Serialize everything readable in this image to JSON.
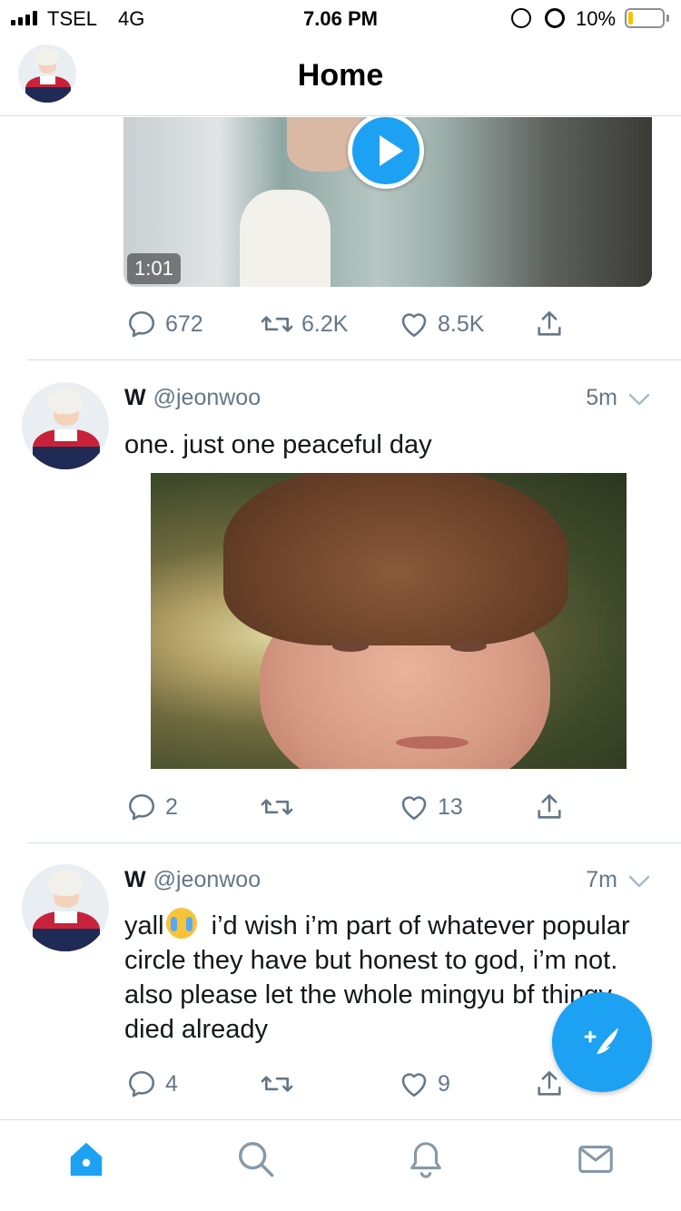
{
  "status_bar": {
    "carrier": "TSEL",
    "network": "4G",
    "time": "7.06 PM",
    "battery_percent": "10%",
    "battery_level": 0.1,
    "icons": [
      "signal-bars-icon",
      "orientation-lock-icon",
      "alarm-icon",
      "battery-icon"
    ]
  },
  "header": {
    "title": "Home"
  },
  "tweets": [
    {
      "media": {
        "type": "video",
        "duration": "1:01"
      },
      "actions": {
        "replies": "672",
        "retweets": "6.2K",
        "likes": "8.5K"
      }
    },
    {
      "name": "W",
      "handle": "@jeonwoo",
      "time": "5m",
      "text": "one. just one peaceful day",
      "media": {
        "type": "photo"
      },
      "actions": {
        "replies": "2",
        "retweets": "",
        "likes": "13"
      }
    },
    {
      "name": "W",
      "handle": "@jeonwoo",
      "time": "7m",
      "text_before_emoji": "yall",
      "emoji": "loudly-crying-face",
      "text_after_emoji": "  i’d wish i’m part of whatever popular circle they have but honest to god, i’m not. also please let the whole mingyu bf thingy died already",
      "actions": {
        "replies": "4",
        "retweets": "",
        "likes": "9"
      }
    }
  ],
  "compose_button": {
    "icon": "compose-feather-icon"
  },
  "tabbar": {
    "items": [
      "home-icon",
      "search-icon",
      "notifications-bell-icon",
      "messages-envelope-icon"
    ],
    "active": "home-icon",
    "active_color": "#1da1f2",
    "inactive_color": "#8899a6"
  },
  "colors": {
    "accent": "#1da1f2",
    "secondary_text": "#657786",
    "divider": "#d8dde1"
  }
}
